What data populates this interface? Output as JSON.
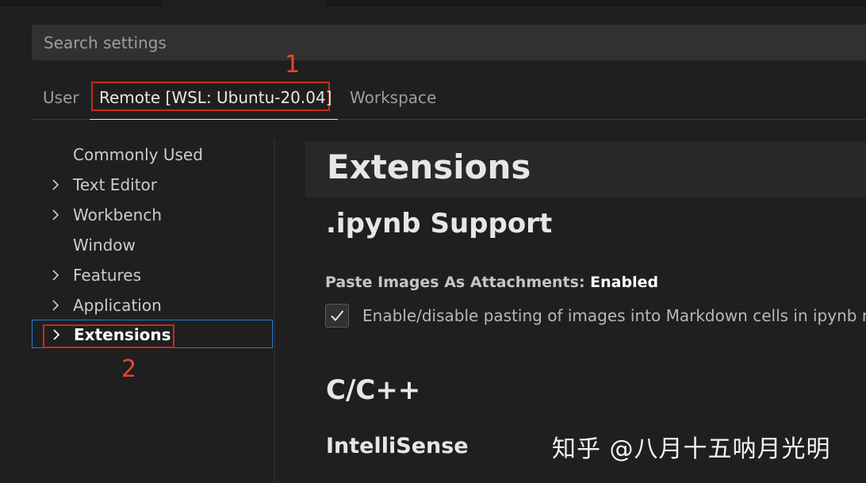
{
  "search": {
    "placeholder": "Search settings"
  },
  "tabs": [
    {
      "label": "User"
    },
    {
      "label": "Remote [WSL: Ubuntu-20.04]"
    },
    {
      "label": "Workspace"
    }
  ],
  "annotations": {
    "one": "1",
    "two": "2"
  },
  "toc": {
    "items": [
      {
        "label": "Commonly Used",
        "expandable": false
      },
      {
        "label": "Text Editor",
        "expandable": true
      },
      {
        "label": "Workbench",
        "expandable": true
      },
      {
        "label": "Window",
        "expandable": false
      },
      {
        "label": "Features",
        "expandable": true
      },
      {
        "label": "Application",
        "expandable": true
      },
      {
        "label": "Extensions",
        "expandable": true,
        "selected": true
      }
    ]
  },
  "content": {
    "section_title": "Extensions",
    "ipynb": {
      "title": ".ipynb Support",
      "setting_name": "Paste Images As Attachments:",
      "setting_value": "Enabled",
      "checkbox_checked": true,
      "description": "Enable/disable pasting of images into Markdown cells in ipynb n"
    },
    "cpp": {
      "title": "C/C++",
      "subtitle": "IntelliSense"
    }
  },
  "watermark": "知乎 @八月十五呐月光明",
  "colors": {
    "background": "#1f1f1f",
    "annotation_red": "#c42b1c",
    "focus_blue": "#2c7bcb"
  }
}
